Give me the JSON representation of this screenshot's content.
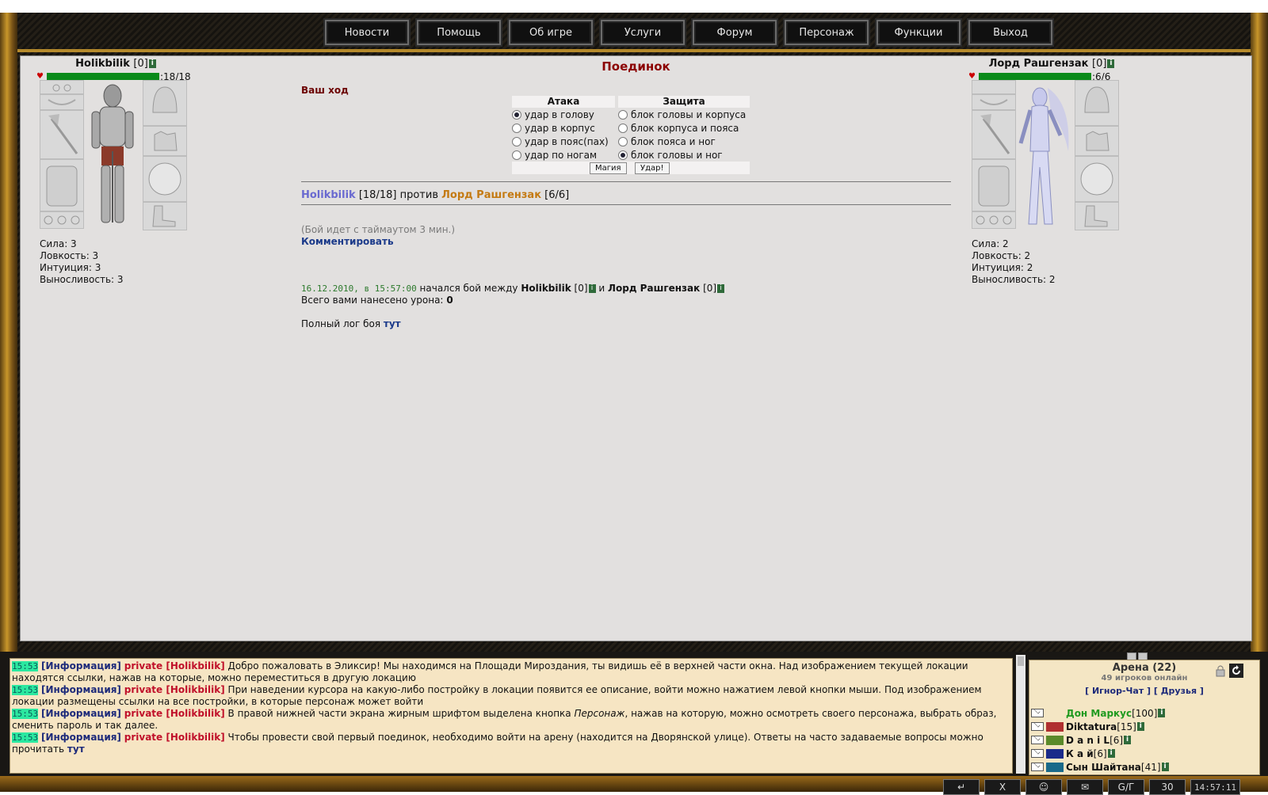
{
  "nav": [
    "Новости",
    "Помощь",
    "Об игре",
    "Услуги",
    "Форум",
    "Персонаж",
    "Функции",
    "Выход"
  ],
  "title": "Поединок",
  "left": {
    "name": "Holikbilik",
    "level": "[0]",
    "info": "i",
    "hp": ":18/18",
    "hp_fraction": 1.0,
    "stats": [
      "Сила: 3",
      "Ловкость: 3",
      "Интуиция: 3",
      "Выносливость: 3"
    ]
  },
  "right": {
    "name": "Лорд Рашгензак",
    "level": "[0]",
    "info": "i",
    "hp": ":6/6",
    "hp_fraction": 1.0,
    "stats": [
      "Сила: 2",
      "Ловкость: 2",
      "Интуиция: 2",
      "Выносливость: 2"
    ]
  },
  "turn_label": "Ваш ход",
  "attack": {
    "header": "Атака",
    "options": [
      "удар в голову",
      "удар в корпус",
      "удар в пояс(пах)",
      "удар по ногам"
    ],
    "selected": 0
  },
  "defense": {
    "header": "Защита",
    "options": [
      "блок головы и корпуса",
      "блок корпуса и пояса",
      "блок пояса и ног",
      "блок головы и ног"
    ],
    "selected": 3
  },
  "buttons": {
    "magic": "Магия",
    "strike": "Удар!"
  },
  "versus": {
    "p1": "Holikbilik",
    "p1_hp": "[18/18]",
    "word": "против",
    "p2": "Лорд Рашгензак",
    "p2_hp": "[6/6]"
  },
  "timeout_text": "(Бой идет с таймаутом 3 мин.)",
  "comment_link": "Комментировать",
  "log": {
    "timestamp": "16.12.2010, в 15:57:00",
    "started": "начался бой между",
    "p1": "Holikbilik",
    "p1_lvl": "[0]",
    "and": "и",
    "p2": "Лорд Рашгензак",
    "p2_lvl": "[0]",
    "damage_label": "Всего вами нанесено урона:",
    "damage_value": "0",
    "full_log_label": "Полный лог боя",
    "full_log_link": "тут"
  },
  "chat": [
    {
      "time": "15:53",
      "tag": "[Информация]",
      "priv": "private [Holikbilik]",
      "text": "Добро пожаловать в Эликсир! Мы находимся на Площади Мироздания, ты видишь её в верхней части окна. Над изображением текущей локации находятся ссылки, нажав на которые, можно переместиться в другую локацию"
    },
    {
      "time": "15:53",
      "tag": "[Информация]",
      "priv": "private [Holikbilik]",
      "text": "При наведении курсора на какую-либо постройку в локации появится ее описание, войти можно нажатием левой кнопки мыши. Под изображением локации размещены ссылки на все постройки, в которые персонаж может войти"
    },
    {
      "time": "15:53",
      "tag": "[Информация]",
      "priv": "private [Holikbilik]",
      "text_before": "В правой нижней части экрана жирным шрифтом выделена кнопка ",
      "text_em": "Персонаж",
      "text_after": ", нажав на которую, можно осмотреть своего персонажа, выбрать образ, сменить пароль и так далее."
    },
    {
      "time": "15:53",
      "tag": "[Информация]",
      "priv": "private [Holikbilik]",
      "text": "Чтобы провести свой первый поединок, необходимо войти на арену (находится на Дворянской улице). Ответы на часто задаваемые вопросы можно прочитать ",
      "link": "тут"
    }
  ],
  "online": {
    "location": "Арена (22)",
    "count": "49 игроков онлайн",
    "ignore": "[ Игнор-Чат ]",
    "friends": "[ Друзья ]",
    "players": [
      {
        "name": "Дон Маркус",
        "level": "[100]",
        "color": "#1f9a1f"
      },
      {
        "name": "Diktatura",
        "level": "[15]",
        "color": "#111111"
      },
      {
        "name": "D a n i L",
        "level": "[6]",
        "color": "#111111"
      },
      {
        "name": "К а й",
        "level": "[6]",
        "color": "#111111"
      },
      {
        "name": "Сын Шайтана",
        "level": "[41]",
        "color": "#111111"
      }
    ]
  },
  "bottom_buttons": [
    "↵",
    "X",
    "☺",
    "✉",
    "G/Г",
    "30"
  ],
  "clock": "14:57:11"
}
